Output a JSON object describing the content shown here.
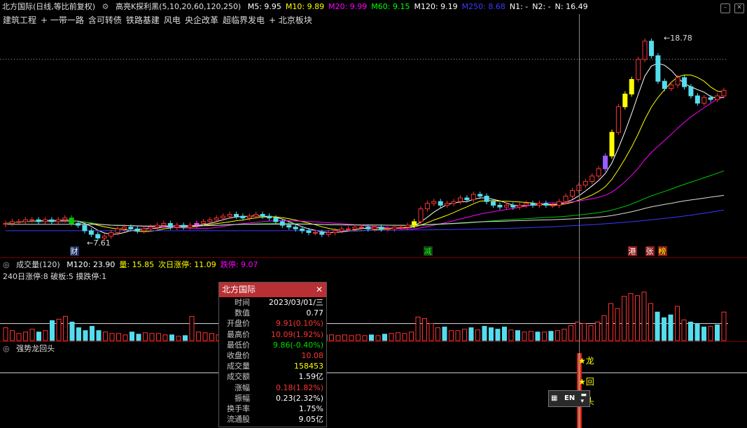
{
  "header": {
    "stock_title": "北方国际(日线,等比前复权)",
    "indicator_name": "高亮K探利黑(5,10,20,60,120,250)",
    "ma_items": [
      {
        "label": "M5: 9.95",
        "color": "#ffffff"
      },
      {
        "label": "M10: 9.89",
        "color": "#ffff00"
      },
      {
        "label": "M20: 9.99",
        "color": "#ff00ff"
      },
      {
        "label": "M60: 9.15",
        "color": "#00ff00"
      },
      {
        "label": "M120: 9.19",
        "color": "#ffffff"
      },
      {
        "label": "M250: 8.68",
        "color": "#3a3aff"
      },
      {
        "label": "N1: -",
        "color": "#ffffff"
      },
      {
        "label": "N2: -",
        "color": "#ffffff"
      },
      {
        "label": "N: 16.49",
        "color": "#ffffff"
      }
    ]
  },
  "concepts": [
    "建筑工程",
    "+ 一带一路",
    "含可转债",
    "铁路基建",
    "风电",
    "央企改革",
    "超临界发电",
    "+ 北京板块"
  ],
  "volume_header": {
    "title": "成交量(120)",
    "items": [
      {
        "label": "M120: 23.90",
        "color": "#ffffff"
      },
      {
        "label": "量: 15.85",
        "color": "#ffff00"
      },
      {
        "label": "次日涨停: 11.09",
        "color": "#ffff00"
      },
      {
        "label": "跌停: 9.07",
        "color": "#ff00ff"
      }
    ],
    "stats": "240日涨停:8 破板:5 摸跌停:1"
  },
  "indicator3": {
    "title": "强势龙回头",
    "labels": [
      "★龙",
      "★回",
      "★头"
    ]
  },
  "event_marks": [
    {
      "text": "财",
      "color": "#ffffff",
      "bg": "#1a2a5a"
    },
    {
      "text": "减",
      "color": "#00ff00",
      "bg": "#1a3a1a"
    },
    {
      "text": "港",
      "color": "#ffffff",
      "bg": "#8a1a1a"
    },
    {
      "text": "张",
      "color": "#ffffff",
      "bg": "#8a1a1a"
    },
    {
      "text": "榜",
      "color": "#ffff00",
      "bg": "#8a1a1a"
    }
  ],
  "info_panel": {
    "title": "北方国际",
    "rows": [
      {
        "k": "时间",
        "v": "2023/03/01/三",
        "color": "#ffffff"
      },
      {
        "k": "数值",
        "v": "0.77",
        "color": "#ffffff"
      },
      {
        "k": "开盘价",
        "v": "9.91(0.10%)",
        "color": "#ff3333"
      },
      {
        "k": "最高价",
        "v": "10.09(1.92%)",
        "color": "#ff3333"
      },
      {
        "k": "最低价",
        "v": "9.86(-0.40%)",
        "color": "#00dd00"
      },
      {
        "k": "收盘价",
        "v": "10.08",
        "color": "#ff3333"
      },
      {
        "k": "成交量",
        "v": "158453",
        "color": "#ffff00"
      },
      {
        "k": "成交额",
        "v": "1.59亿",
        "color": "#ffffff"
      },
      {
        "k": "涨幅",
        "v": "0.18(1.82%)",
        "color": "#ff3333"
      },
      {
        "k": "振幅",
        "v": "0.23(2.32%)",
        "color": "#ffffff"
      },
      {
        "k": "换手率",
        "v": "1.75%",
        "color": "#ffffff"
      },
      {
        "k": "流通股",
        "v": "9.05亿",
        "color": "#ffffff"
      }
    ]
  },
  "ime": {
    "label": "EN"
  },
  "chart_data": {
    "type": "candlestick",
    "price_range": [
      7.2,
      19.4
    ],
    "max_label": "18.78",
    "min_label": "7.61",
    "closes": [
      8.6,
      8.7,
      8.7,
      8.8,
      8.8,
      8.7,
      8.8,
      8.7,
      8.8,
      8.9,
      8.6,
      8.5,
      8.2,
      8.0,
      7.8,
      7.9,
      8.1,
      8.3,
      8.4,
      8.3,
      8.2,
      8.3,
      8.4,
      8.5,
      8.6,
      8.4,
      8.5,
      8.4,
      8.5,
      8.6,
      8.7,
      8.8,
      8.9,
      9.0,
      9.1,
      9.0,
      8.9,
      9.0,
      9.1,
      9.0,
      8.9,
      8.7,
      8.5,
      8.4,
      8.3,
      8.2,
      8.1,
      8.1,
      8.0,
      8.1,
      8.2,
      8.3,
      8.3,
      8.4,
      8.4,
      8.3,
      8.4,
      8.3,
      8.3,
      8.4,
      8.4,
      8.5,
      8.7,
      9.4,
      9.7,
      9.8,
      9.6,
      9.7,
      9.8,
      10.0,
      9.9,
      10.2,
      10.1,
      9.8,
      9.6,
      9.5,
      9.6,
      9.5,
      9.6,
      9.7,
      9.6,
      9.7,
      9.6,
      9.6,
      9.8,
      10.1,
      10.4,
      10.7,
      10.9,
      11.2,
      11.6,
      12.3,
      13.6,
      15.0,
      15.7,
      16.5,
      17.6,
      18.6,
      17.8,
      16.4,
      16.0,
      16.2,
      16.6,
      16.1,
      15.6,
      15.2,
      15.5,
      15.4,
      15.6,
      15.9
    ],
    "volume_max": 100,
    "volumes": [
      18,
      14,
      10,
      12,
      16,
      12,
      14,
      28,
      30,
      34,
      26,
      18,
      14,
      20,
      14,
      12,
      10,
      10,
      8,
      12,
      9,
      11,
      10,
      10,
      8,
      8,
      6,
      7,
      34,
      12,
      11,
      10,
      8,
      8,
      7,
      6,
      6,
      8,
      7,
      7,
      8,
      7,
      10,
      8,
      8,
      9,
      8,
      7,
      8,
      8,
      7,
      8,
      7,
      8,
      7,
      8,
      7,
      9,
      10,
      11,
      10,
      12,
      33,
      31,
      24,
      18,
      19,
      14,
      14,
      16,
      18,
      15,
      20,
      18,
      16,
      19,
      15,
      14,
      12,
      13,
      12,
      12,
      13,
      14,
      16,
      21,
      26,
      24,
      21,
      26,
      35,
      52,
      45,
      62,
      66,
      63,
      68,
      52,
      40,
      32,
      36,
      48,
      29,
      26,
      24,
      19,
      20,
      22,
      40
    ],
    "volume_ma": 23.9
  }
}
